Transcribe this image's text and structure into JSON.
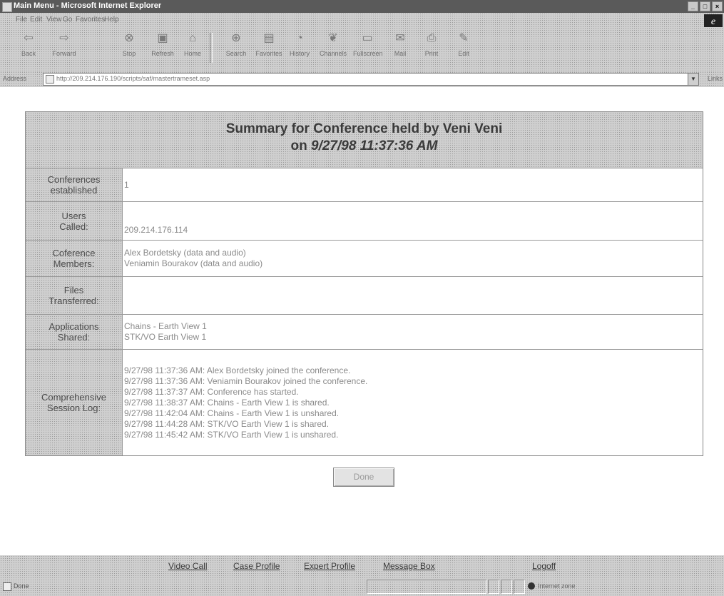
{
  "window": {
    "title": "Main Menu - Microsoft Internet Explorer"
  },
  "menu": [
    "File",
    "Edit",
    "View",
    "Go",
    "Favorites",
    "Help"
  ],
  "toolbar": {
    "buttons": [
      {
        "label": "Back",
        "icon": "back-arrow-icon"
      },
      {
        "label": "Forward",
        "icon": "forward-arrow-icon"
      },
      {
        "label": "Stop",
        "icon": "stop-icon"
      },
      {
        "label": "Refresh",
        "icon": "refresh-icon"
      },
      {
        "label": "Home",
        "icon": "home-icon"
      },
      {
        "label": "Search",
        "icon": "search-icon"
      },
      {
        "label": "Favorites",
        "icon": "favorites-icon"
      },
      {
        "label": "History",
        "icon": "history-icon"
      },
      {
        "label": "Channels",
        "icon": "channels-icon"
      },
      {
        "label": "Fullscreen",
        "icon": "fullscreen-icon"
      },
      {
        "label": "Mail",
        "icon": "mail-icon"
      },
      {
        "label": "Print",
        "icon": "print-icon"
      },
      {
        "label": "Edit",
        "icon": "edit-icon"
      }
    ]
  },
  "address": {
    "label": "Address",
    "url": "http://209.214.176.190/scripts/saf/mastertrameset.asp",
    "links_label": "Links"
  },
  "summary": {
    "title_line1": "Summary for Conference held by Veni Veni",
    "title_line2_prefix": "on ",
    "title_date": "9/27/98 11:37:36 AM",
    "rows": {
      "conferences": {
        "label_line1": "Conferences",
        "label_line2": "established",
        "value": "1"
      },
      "users": {
        "label_line1": "Users",
        "label_line2": "Called:",
        "value": "209.214.176.114"
      },
      "members": {
        "label_line1": "Coference",
        "label_line2": "Members:",
        "values": [
          "Alex Bordetsky (data and audio)",
          "Veniamin Bourakov (data and audio)"
        ]
      },
      "files": {
        "label_line1": "Files",
        "label_line2": "Transferred:",
        "value": ""
      },
      "applications": {
        "label_line1": "Applications",
        "label_line2": "Shared:",
        "values": [
          "Chains - Earth View 1",
          "STK/VO Earth View 1"
        ]
      },
      "log": {
        "label_line1": "Comprehensive",
        "label_line2": "Session Log:",
        "values": [
          "9/27/98 11:37:36 AM: Alex Bordetsky joined the conference.",
          "9/27/98 11:37:36 AM: Veniamin Bourakov joined the conference.",
          "9/27/98 11:37:37 AM: Conference has started.",
          "9/27/98 11:38:37 AM: Chains - Earth View 1 is shared.",
          "9/27/98 11:42:04 AM: Chains - Earth View 1 is unshared.",
          "9/27/98 11:44:28 AM: STK/VO Earth View 1 is shared.",
          "9/27/98 11:45:42 AM: STK/VO Earth View 1 is unshared."
        ]
      }
    }
  },
  "done_button": "Done",
  "bottom_nav": [
    "Video Call",
    "Case Profile",
    "Expert Profile",
    "Message Box",
    "Logoff"
  ],
  "status": {
    "text": "Done",
    "zone": "Internet zone"
  }
}
